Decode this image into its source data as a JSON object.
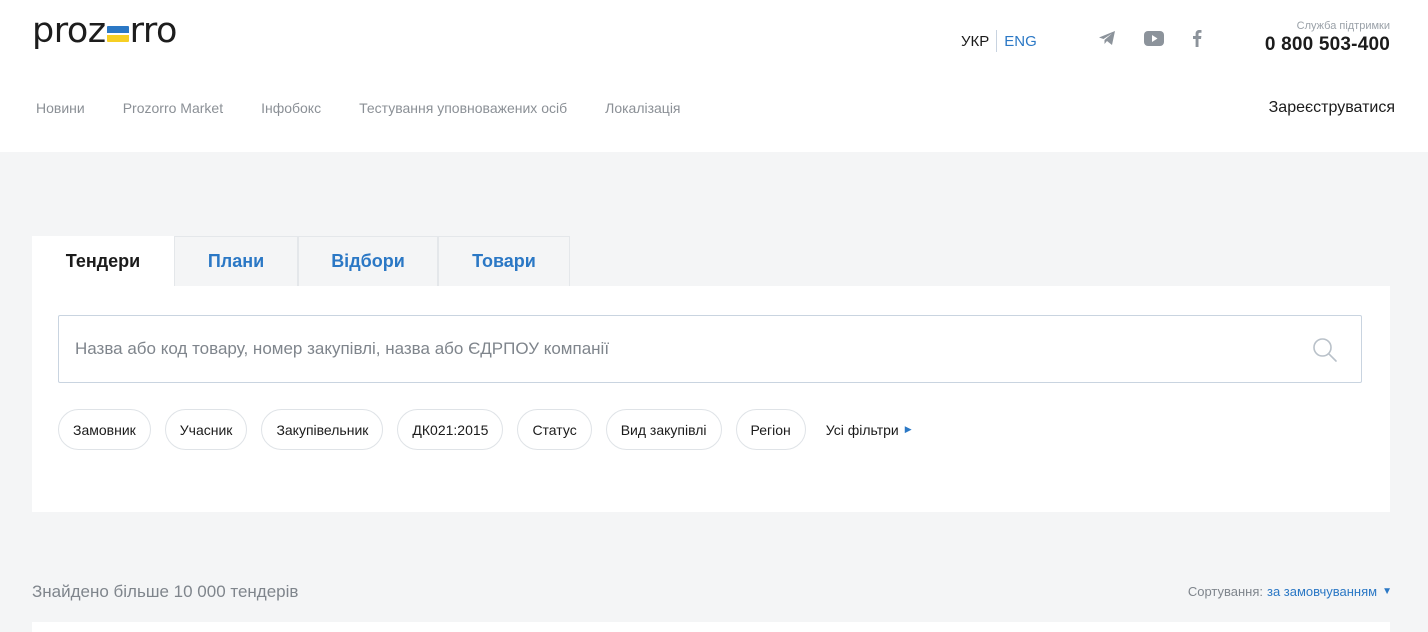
{
  "header": {
    "logo": {
      "left": "proz",
      "right": "rro",
      "flag_colors": [
        "#2b78c5",
        "#f6cf24"
      ]
    },
    "language": {
      "active": "УКР",
      "other": "ENG"
    },
    "social": [
      "telegram-icon",
      "youtube-icon",
      "facebook-icon"
    ],
    "support": {
      "label": "Служба підтримки",
      "phone": "0 800 503-400"
    },
    "nav": [
      "Новини",
      "Prozorro Market",
      "Інфобокс",
      "Тестування уповноважених осіб",
      "Локалізація"
    ],
    "register": "Зареєструватися"
  },
  "tabs": [
    {
      "label": "Тендери",
      "active": true
    },
    {
      "label": "Плани",
      "active": false
    },
    {
      "label": "Відбори",
      "active": false
    },
    {
      "label": "Товари",
      "active": false
    }
  ],
  "search": {
    "placeholder": "Назва або код товару, номер закупівлі, назва або ЄДРПОУ компанії",
    "value": ""
  },
  "filters": [
    "Замовник",
    "Учасник",
    "Закупівельник",
    "ДК021:2015",
    "Статус",
    "Вид закупівлі",
    "Регіон"
  ],
  "all_filters": "Усі фільтри",
  "results": {
    "found": "Знайдено більше 10 000 тендерів",
    "sort_label": "Сортування:",
    "sort_value": "за замовчуванням"
  },
  "colors": {
    "accent": "#2b78c5",
    "background": "#f4f5f6",
    "muted": "#7f858c"
  }
}
